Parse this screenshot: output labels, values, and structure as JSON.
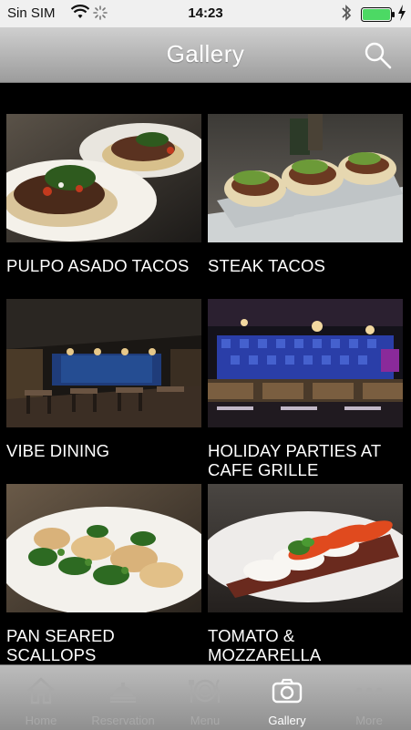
{
  "status": {
    "carrier": "Sin SIM",
    "time": "14:23"
  },
  "header": {
    "title": "Gallery"
  },
  "gallery": {
    "items": [
      {
        "caption": "PULPO ASADO TACOS"
      },
      {
        "caption": "STEAK TACOS"
      },
      {
        "caption": "VIBE DINING"
      },
      {
        "caption": "HOLIDAY PARTIES AT CAFE GRILLE"
      },
      {
        "caption": "PAN SEARED SCALLOPS"
      },
      {
        "caption": "TOMATO & MOZZARELLA"
      }
    ]
  },
  "tabs": [
    {
      "label": "Home",
      "icon": "home-icon"
    },
    {
      "label": "Reservation",
      "icon": "reservation-icon"
    },
    {
      "label": "Menu",
      "icon": "menu-icon"
    },
    {
      "label": "Gallery",
      "icon": "camera-icon",
      "active": true
    },
    {
      "label": "More",
      "icon": "more-icon"
    }
  ],
  "colors": {
    "background": "#000000",
    "nav_gradient_top": "#cfcfcf",
    "nav_gradient_bottom": "#9c9c9c",
    "battery_green": "#4cd964",
    "tab_inactive": "#a9a9a9",
    "tab_active": "#ffffff"
  }
}
